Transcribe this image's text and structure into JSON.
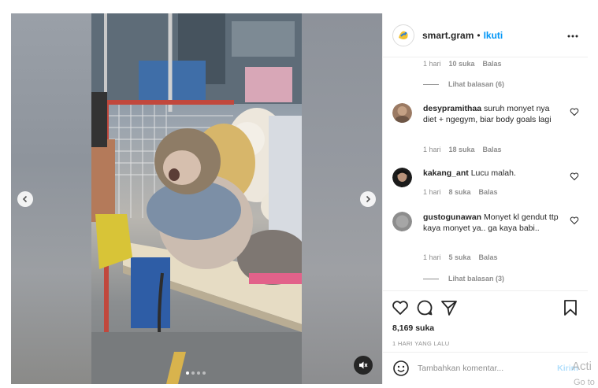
{
  "post": {
    "username": "smart.gram",
    "separator": "•",
    "follow_label": "Ikuti",
    "more_icon": "more-options-icon"
  },
  "media": {
    "slide_count": 4,
    "active_slide": 1,
    "prev_icon": "chevron-left-icon",
    "next_icon": "chevron-right-icon",
    "mute_icon": "speaker-muted-icon"
  },
  "comments": {
    "top_meta": {
      "time": "1 hari",
      "likes": "10 suka",
      "reply": "Balas"
    },
    "top_view_replies": "Lihat balasan (6)",
    "items": [
      {
        "username": "desypramithaa",
        "text": "suruh monyet nya diet + ngegym, biar body goals lagi",
        "time": "1 hari",
        "likes": "18 suka",
        "reply": "Balas"
      },
      {
        "username": "kakang_ant",
        "text": "Lucu malah.",
        "time": "1 hari",
        "likes": "8 suka",
        "reply": "Balas"
      },
      {
        "username": "gustogunawan",
        "text": "Monyet kl gendut ttp kaya monyet ya.. ga kaya babi..",
        "time": "1 hari",
        "likes": "5 suka",
        "reply": "Balas",
        "view_replies": "Lihat balasan (3)"
      }
    ]
  },
  "actions": {
    "like_icon": "heart-icon",
    "comment_icon": "comment-icon",
    "share_icon": "send-icon",
    "save_icon": "bookmark-icon",
    "likes_count": "8,169 suka",
    "time_ago": "1 HARI YANG LALU"
  },
  "add_comment": {
    "placeholder": "Tambahkan komentar...",
    "post_label": "Kirim",
    "emoji_icon": "emoji-icon"
  },
  "overlay": {
    "watermark_line1": "Acti",
    "watermark_line2": "Go to"
  },
  "colors": {
    "accent": "#0095f6",
    "post_disabled": "#b2dffc",
    "text": "#262626",
    "muted": "#8e8e8e",
    "border": "#efefef"
  }
}
